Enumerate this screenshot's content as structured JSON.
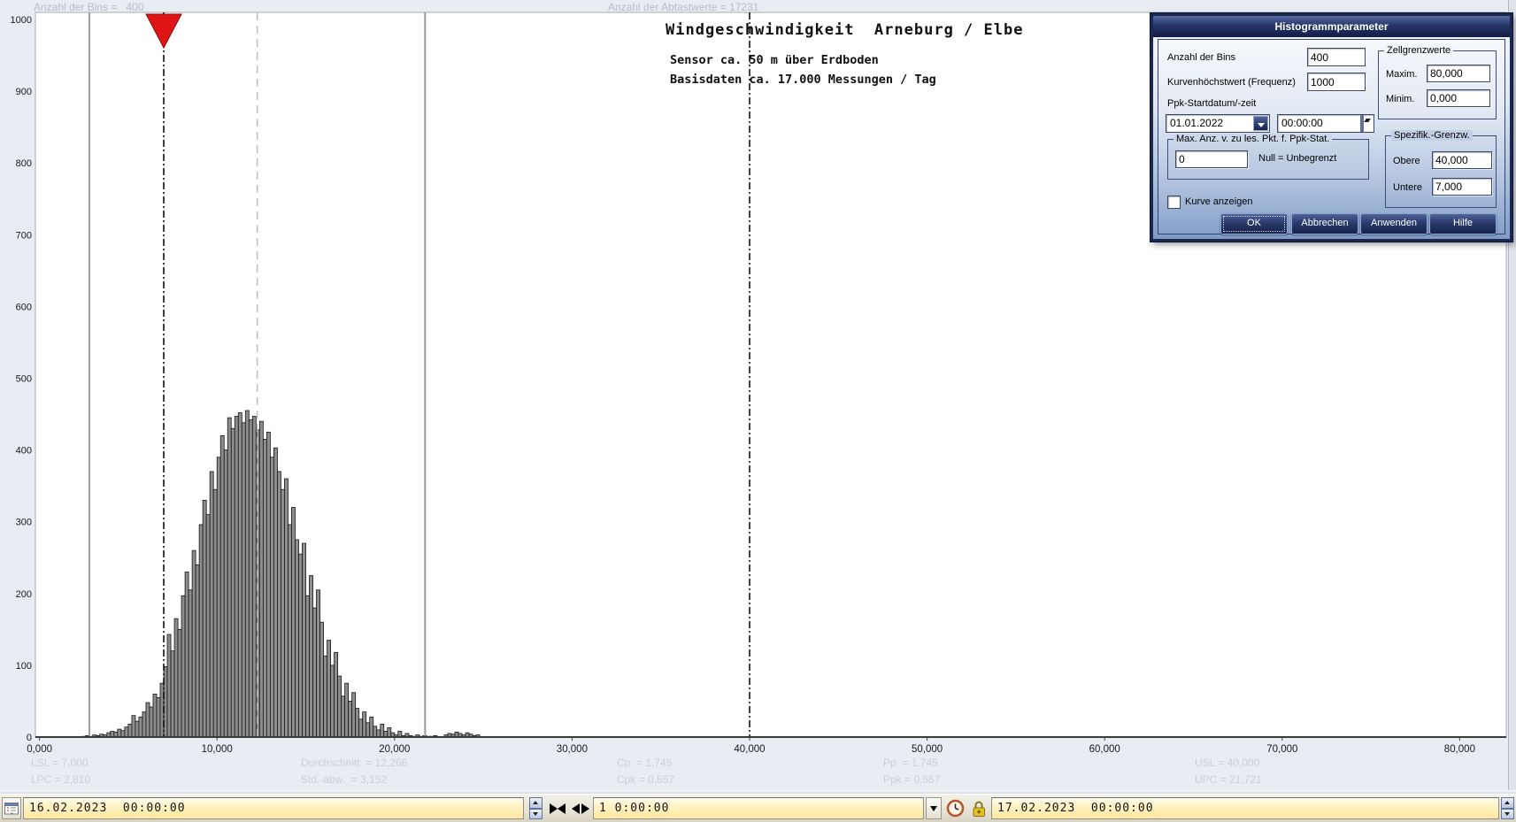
{
  "colors": {
    "page_bg": "#e9ecf2",
    "plot_bg": "#ffffff",
    "plot_frame": "#a9abb0",
    "bar_fill": "#8e8e8e",
    "bar_stroke": "#151515",
    "limit_line": "#000000",
    "mean_line": "#bcbfc6",
    "pc_line": "#9b9b9b",
    "marker_red": "#e01414",
    "stats_text": "#c9cedb",
    "faint_text": "#b7bdc9",
    "dialog_navy": "#1b2850",
    "toolbar_yellow": "#ffe79c"
  },
  "chart_data": {
    "type": "bar",
    "title": "Windgeschwindigkeit  Arneburg / Elbe",
    "subtitle1": "Sensor ca. 50 m über Erdboden",
    "subtitle2": "Basisdaten ca. 17.000 Messungen / Tag",
    "top_left_label": "Anzahl der Bins =   400",
    "top_center_label": "Anzahl der Abtastwerte = 17231",
    "xlabel": "",
    "ylabel": "",
    "xlim": [
      0,
      80000
    ],
    "ylim": [
      0,
      1000
    ],
    "grid": false,
    "legend": false,
    "x_ticks": [
      {
        "value": 0,
        "label": "0,000"
      },
      {
        "value": 10000,
        "label": "10,000"
      },
      {
        "value": 20000,
        "label": "20,000"
      },
      {
        "value": 30000,
        "label": "30,000"
      },
      {
        "value": 40000,
        "label": "40,000"
      },
      {
        "value": 50000,
        "label": "50,000"
      },
      {
        "value": 60000,
        "label": "60,000"
      },
      {
        "value": 70000,
        "label": "70,000"
      },
      {
        "value": 80000,
        "label": "80,000"
      }
    ],
    "y_ticks": [
      0,
      100,
      200,
      300,
      400,
      500,
      600,
      700,
      800,
      900,
      1000
    ],
    "bin_start": 2400,
    "bin_width": 200,
    "counts": [
      1,
      2,
      1,
      3,
      2,
      4,
      3,
      6,
      8,
      7,
      11,
      9,
      14,
      18,
      30,
      22,
      28,
      35,
      48,
      42,
      60,
      55,
      75,
      98,
      143,
      120,
      165,
      150,
      197,
      230,
      205,
      260,
      240,
      296,
      330,
      310,
      370,
      345,
      390,
      420,
      400,
      445,
      430,
      447,
      452,
      438,
      455,
      442,
      447,
      428,
      440,
      415,
      425,
      390,
      403,
      370,
      345,
      360,
      296,
      320,
      275,
      255,
      270,
      197,
      225,
      180,
      205,
      160,
      113,
      135,
      100,
      118,
      85,
      57,
      75,
      50,
      62,
      40,
      25,
      35,
      20,
      28,
      15,
      10,
      18,
      8,
      13,
      6,
      3,
      8,
      2,
      5,
      2,
      1,
      3,
      1,
      2,
      1,
      1,
      2,
      0,
      0,
      3,
      5,
      4,
      7,
      5,
      3,
      6,
      4,
      2,
      3
    ],
    "ref_lines": [
      {
        "name": "LPC",
        "value": 2810,
        "style": "solid",
        "color": "#9b9b9b",
        "width": 2
      },
      {
        "name": "LSL",
        "value": 7000,
        "style": "dashdot",
        "color": "#000000",
        "width": 1.5,
        "marker": "red-triangle"
      },
      {
        "name": "Durchschnitt",
        "value": 12266,
        "style": "dashed",
        "color": "#bcbfc6",
        "width": 1.5
      },
      {
        "name": "UPC",
        "value": 21721,
        "style": "solid",
        "color": "#9b9b9b",
        "width": 2
      },
      {
        "name": "USL",
        "value": 40000,
        "style": "dashdot",
        "color": "#000000",
        "width": 1.5
      }
    ],
    "stats": {
      "columns": [
        {
          "x": 35,
          "lines": [
            "LSL = 7,000",
            "LPC = 2,810"
          ]
        },
        {
          "x": 340,
          "lines": [
            "Durchschnitt  = 12,266",
            "Std.-abw.  = 3,152"
          ]
        },
        {
          "x": 697,
          "lines": [
            "Cp  = 1,745",
            "Cpk = 0,557"
          ]
        },
        {
          "x": 998,
          "lines": [
            "Pp  = 1,745",
            "Ppk = 0,557"
          ]
        },
        {
          "x": 1350,
          "lines": [
            "USL = 40,000",
            "UPC = 21,721"
          ]
        }
      ]
    }
  },
  "dialog": {
    "title": "Histogrammparameter",
    "bins_label": "Anzahl der Bins",
    "bins_value": "400",
    "freq_label": "Kurvenhöchstwert (Frequenz)",
    "freq_value": "1000",
    "ppk_label": "Ppk-Startdatum/-zeit",
    "date_value": "01.01.2022",
    "time_value": "00:00:00",
    "maxpts_group": "Max. Anz. v. zu les. Pkt. f. Ppk-Stat.",
    "maxpts_value": "0",
    "maxpts_hint": "Null = Unbegrenzt",
    "cell_group": "Zellgrenzwerte",
    "max_label": "Maxim.",
    "max_value": "80,000",
    "min_label": "Minim.",
    "min_value": "0,000",
    "spec_group": "Spezifik.-Grenzw.",
    "upper_label": "Obere",
    "upper_value": "40,000",
    "lower_label": "Untere",
    "lower_value": "7,000",
    "curve_checkbox_label": "Kurve anzeigen",
    "curve_checked": false,
    "buttons": {
      "ok": "OK",
      "cancel": "Abbrechen",
      "apply": "Anwenden",
      "help": "Hilfe"
    }
  },
  "toolbar": {
    "start_datetime": "16.02.2023  00:00:00",
    "interval": "1 0:00:00",
    "end_datetime": "17.02.2023  00:00:00",
    "icons": [
      "calendar-icon",
      "compress-arrows-icon",
      "expand-arrows-icon",
      "dropdown-arrow-icon",
      "clock-icon",
      "lock-icon"
    ]
  }
}
